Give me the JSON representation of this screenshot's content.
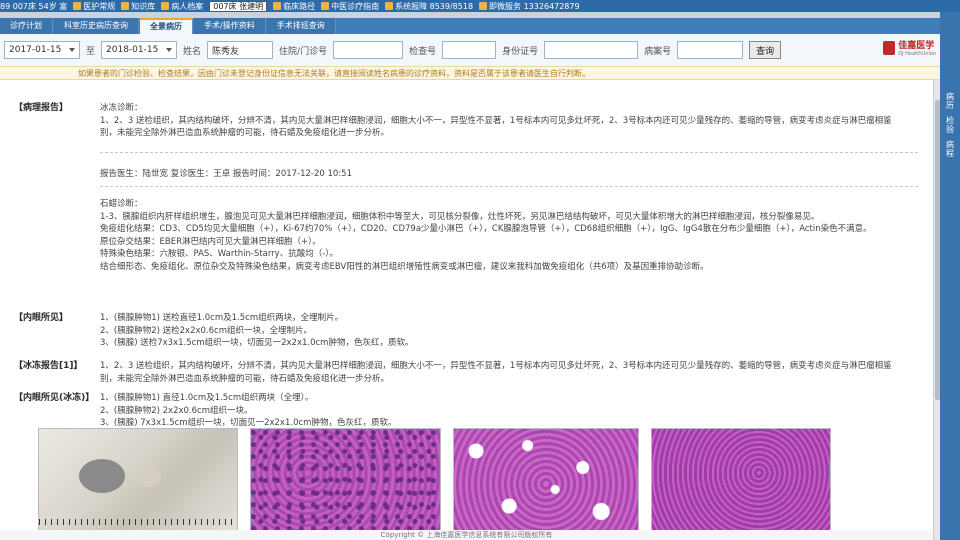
{
  "sysbar": {
    "patient_info": "89 007床 54岁 富",
    "tools": [
      {
        "label": "医护常规",
        "icon": "book-icon"
      },
      {
        "label": "知识库",
        "icon": "book-icon"
      },
      {
        "label": "病人档案",
        "icon": "folder-icon"
      }
    ],
    "bed_selector": "007床 张建明",
    "links": [
      {
        "label": "临床路径",
        "icon": "path-icon"
      },
      {
        "label": "中医诊疗指南",
        "icon": "guide-icon"
      },
      {
        "label": "系统报障 8539/8518",
        "icon": "alert-icon"
      },
      {
        "label": "即微服务 13326472879",
        "icon": "phone-icon"
      }
    ]
  },
  "tabs": [
    {
      "label": "诊疗计划",
      "active": false
    },
    {
      "label": "科室历史病历查询",
      "active": false
    },
    {
      "label": "全景病历",
      "active": true
    },
    {
      "label": "手术/操作资料",
      "active": false
    },
    {
      "label": "手术排班查询",
      "active": false
    }
  ],
  "search": {
    "date_from": "2017-01-15",
    "to_label": "至",
    "date_to": "2018-01-15",
    "name_label": "姓名",
    "name_value": "陈秀友",
    "inpatient_label": "住院/门诊号",
    "exam_label": "检查号",
    "id_label": "身份证号",
    "case_label": "病案号",
    "query_button": "查询"
  },
  "brand": {
    "name": "佳嘉医学",
    "sub": "DJ HealthUnion"
  },
  "notice": "如果患者的门诊检验、检查结果，因由门诊未登记身份证信息无法关联，请直接阅读姓名病患的诊疗资料，资料是否属于该患者请医生自行判断。",
  "pathology": {
    "label": "【病理报告】",
    "frozen_title": "冰冻诊断：",
    "frozen_text": "1、2、3 送检组织，其内结构破坏，分辨不清，其内见大量淋巴样细胞浸润，细胞大小不一，异型性不显著，1号标本内可见多灶坏死，2、3号标本内还可见少量残存的、萎缩的导管，病变考虑炎症与淋巴瘤相鉴别，未能完全除外淋巴造血系统肿瘤的可能，待石蜡及免疫组化进一步分析。",
    "reporters": "报告医生：陆世宽  复诊医生：王卓  报告时间：2017-12-20 10:51",
    "paraffin_title": "石蜡诊断：",
    "paraffin_text": "1-3、胰腺组织内肝样组织增生，腺泡见可见大量淋巴样细胞浸润，细胞体积中等至大，可见核分裂像，灶性坏死，另见淋巴结结构破坏，可见大量体积增大的淋巴样细胞浸润，核分裂像易见。",
    "ihc": "免疫组化结果：CD3、CD5均见大量细胞（+），Ki-67约70%（+），CD20、CD79a少量小淋巴（+），CK腺腺泡导管（+），CD68组织细胞（+），IgG、IgG4散在分布少量细胞（+），Actin染色不满意。",
    "ish": "原位杂交结果：EBER淋巴结内可见大量淋巴样细胞（+）。",
    "special": "特殊染色结果：六胺银、PAS、Warthin-Starry、抗酸均（-）。",
    "conclusion": "结合细形态、免疫组化、原位杂交及特殊染色结果，病变考虑EBV阳性的淋巴组织增殖性病变或淋巴瘤，建议来我科加做免疫组化（共6项）及基因重排协助诊断。"
  },
  "internal_findings": {
    "label": "【内眼所见】",
    "lines": [
      "1、(胰腺肿物1) 送检直径1.0cm及1.5cm组织两块，全埋制片。",
      "2、(胰腺肿物2) 送检2x2x0.6cm组织一块，全埋制片。",
      "3、(胰腺) 送检7x3x1.5cm组织一块，切面见一2x2x1.0cm肿物，色灰红，质软。"
    ]
  },
  "frozen_section": {
    "label": "【冰冻报告[1]】",
    "lines": [
      "1、2、3 送检组织，其内结构破坏，分辨不清，其内见大量淋巴样细胞浸润，细胞大小不一，异型性不显著，1号标本内可见多灶坏死，2、3号标本内还可见少量残存的、萎缩的导管，病变考虑炎症与淋巴瘤相鉴别，未能完全除外淋巴造血系统肿瘤的可能，待石蜡及免疫组化进一步分析。"
    ]
  },
  "frozen_gross": {
    "label": "【内眼所见(冰冻)】",
    "lines": [
      "1、(胰腺肿物1) 直径1.0cm及1.5cm组织两块（全埋）。",
      "2、(胰腺肿物2) 2x2x0.6cm组织一块。",
      "3、(胰腺) 7x3x1.5cm组织一块，切面见一2x2x1.0cm肿物，色灰红，质软。"
    ]
  },
  "right_panel": [
    "病历",
    "检验",
    "病程"
  ],
  "footer": "Copyright © 上海佳嘉医学信息系统有限公司版权所有"
}
